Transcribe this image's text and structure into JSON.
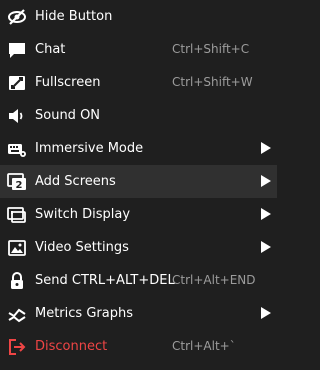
{
  "menu": {
    "items": [
      {
        "label": "Hide Button",
        "shortcut": "",
        "icon": "eye-slash-icon"
      },
      {
        "label": "Chat",
        "shortcut": "Ctrl+Shift+C",
        "icon": "chat-bubble-icon"
      },
      {
        "label": "Fullscreen",
        "shortcut": "Ctrl+Shift+W",
        "icon": "fullscreen-icon"
      },
      {
        "label": "Sound ON",
        "shortcut": "",
        "icon": "speaker-icon"
      },
      {
        "label": "Immersive Mode",
        "shortcut": "",
        "icon": "keyboard-icon",
        "submenu": true
      },
      {
        "label": "Add Screens",
        "shortcut": "",
        "icon": "screens-2-icon",
        "submenu": true,
        "highlighted": true
      },
      {
        "label": "Switch Display",
        "shortcut": "",
        "icon": "switch-display-icon",
        "submenu": true
      },
      {
        "label": "Video Settings",
        "shortcut": "",
        "icon": "image-settings-icon",
        "submenu": true
      },
      {
        "label": "Send CTRL+ALT+DEL",
        "shortcut": "Ctrl+Alt+END",
        "icon": "lock-icon"
      },
      {
        "label": "Metrics Graphs",
        "shortcut": "",
        "icon": "graph-icon",
        "submenu": true
      },
      {
        "label": "Disconnect",
        "shortcut": "Ctrl+Alt+`",
        "icon": "disconnect-icon",
        "danger": true
      }
    ]
  },
  "colors": {
    "background": "#1f1f1f",
    "highlight": "#303030",
    "text": "#ffffff",
    "shortcut": "#9c9c9c",
    "danger": "#ef4545"
  }
}
